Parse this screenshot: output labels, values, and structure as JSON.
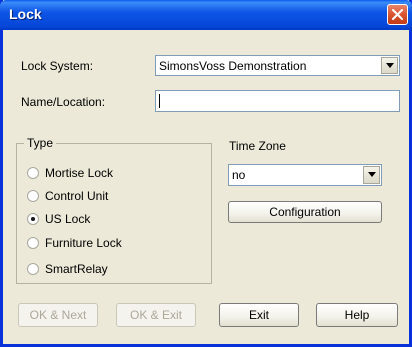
{
  "window": {
    "title": "Lock"
  },
  "form": {
    "lock_system_label": "Lock System:",
    "lock_system_value": "SimonsVoss Demonstration",
    "name_location_label": "Name/Location:",
    "name_location_value": ""
  },
  "type_group": {
    "title": "Type",
    "options": [
      {
        "label": "Mortise Lock",
        "selected": false
      },
      {
        "label": "Control Unit",
        "selected": false
      },
      {
        "label": "US Lock",
        "selected": true
      },
      {
        "label": "Furniture Lock",
        "selected": false
      },
      {
        "label": "SmartRelay",
        "selected": false
      }
    ]
  },
  "time_zone": {
    "label": "Time Zone",
    "value": "no",
    "configuration_label": "Configuration"
  },
  "buttons": {
    "ok_next": "OK & Next",
    "ok_exit": "OK & Exit",
    "exit": "Exit",
    "help": "Help"
  },
  "colors": {
    "titlebar": "#0546d8",
    "dialog_bg": "#ece9d8",
    "close_button": "#d9542f",
    "disabled_text": "#aca899"
  },
  "icons": {
    "close": "close-icon",
    "dropdown": "chevron-down-icon"
  }
}
